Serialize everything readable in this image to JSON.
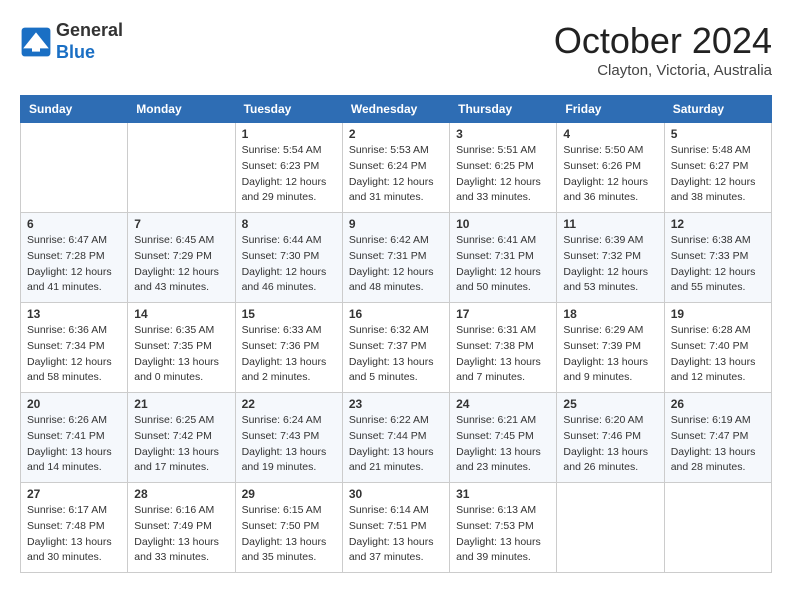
{
  "header": {
    "logo_line1": "General",
    "logo_line2": "Blue",
    "month": "October 2024",
    "location": "Clayton, Victoria, Australia"
  },
  "days_of_week": [
    "Sunday",
    "Monday",
    "Tuesday",
    "Wednesday",
    "Thursday",
    "Friday",
    "Saturday"
  ],
  "weeks": [
    [
      {
        "day": null
      },
      {
        "day": null
      },
      {
        "day": "1",
        "sunrise": "5:54 AM",
        "sunset": "6:23 PM",
        "daylight": "12 hours and 29 minutes."
      },
      {
        "day": "2",
        "sunrise": "5:53 AM",
        "sunset": "6:24 PM",
        "daylight": "12 hours and 31 minutes."
      },
      {
        "day": "3",
        "sunrise": "5:51 AM",
        "sunset": "6:25 PM",
        "daylight": "12 hours and 33 minutes."
      },
      {
        "day": "4",
        "sunrise": "5:50 AM",
        "sunset": "6:26 PM",
        "daylight": "12 hours and 36 minutes."
      },
      {
        "day": "5",
        "sunrise": "5:48 AM",
        "sunset": "6:27 PM",
        "daylight": "12 hours and 38 minutes."
      }
    ],
    [
      {
        "day": "6",
        "sunrise": "6:47 AM",
        "sunset": "7:28 PM",
        "daylight": "12 hours and 41 minutes."
      },
      {
        "day": "7",
        "sunrise": "6:45 AM",
        "sunset": "7:29 PM",
        "daylight": "12 hours and 43 minutes."
      },
      {
        "day": "8",
        "sunrise": "6:44 AM",
        "sunset": "7:30 PM",
        "daylight": "12 hours and 46 minutes."
      },
      {
        "day": "9",
        "sunrise": "6:42 AM",
        "sunset": "7:31 PM",
        "daylight": "12 hours and 48 minutes."
      },
      {
        "day": "10",
        "sunrise": "6:41 AM",
        "sunset": "7:31 PM",
        "daylight": "12 hours and 50 minutes."
      },
      {
        "day": "11",
        "sunrise": "6:39 AM",
        "sunset": "7:32 PM",
        "daylight": "12 hours and 53 minutes."
      },
      {
        "day": "12",
        "sunrise": "6:38 AM",
        "sunset": "7:33 PM",
        "daylight": "12 hours and 55 minutes."
      }
    ],
    [
      {
        "day": "13",
        "sunrise": "6:36 AM",
        "sunset": "7:34 PM",
        "daylight": "12 hours and 58 minutes."
      },
      {
        "day": "14",
        "sunrise": "6:35 AM",
        "sunset": "7:35 PM",
        "daylight": "13 hours and 0 minutes."
      },
      {
        "day": "15",
        "sunrise": "6:33 AM",
        "sunset": "7:36 PM",
        "daylight": "13 hours and 2 minutes."
      },
      {
        "day": "16",
        "sunrise": "6:32 AM",
        "sunset": "7:37 PM",
        "daylight": "13 hours and 5 minutes."
      },
      {
        "day": "17",
        "sunrise": "6:31 AM",
        "sunset": "7:38 PM",
        "daylight": "13 hours and 7 minutes."
      },
      {
        "day": "18",
        "sunrise": "6:29 AM",
        "sunset": "7:39 PM",
        "daylight": "13 hours and 9 minutes."
      },
      {
        "day": "19",
        "sunrise": "6:28 AM",
        "sunset": "7:40 PM",
        "daylight": "13 hours and 12 minutes."
      }
    ],
    [
      {
        "day": "20",
        "sunrise": "6:26 AM",
        "sunset": "7:41 PM",
        "daylight": "13 hours and 14 minutes."
      },
      {
        "day": "21",
        "sunrise": "6:25 AM",
        "sunset": "7:42 PM",
        "daylight": "13 hours and 17 minutes."
      },
      {
        "day": "22",
        "sunrise": "6:24 AM",
        "sunset": "7:43 PM",
        "daylight": "13 hours and 19 minutes."
      },
      {
        "day": "23",
        "sunrise": "6:22 AM",
        "sunset": "7:44 PM",
        "daylight": "13 hours and 21 minutes."
      },
      {
        "day": "24",
        "sunrise": "6:21 AM",
        "sunset": "7:45 PM",
        "daylight": "13 hours and 23 minutes."
      },
      {
        "day": "25",
        "sunrise": "6:20 AM",
        "sunset": "7:46 PM",
        "daylight": "13 hours and 26 minutes."
      },
      {
        "day": "26",
        "sunrise": "6:19 AM",
        "sunset": "7:47 PM",
        "daylight": "13 hours and 28 minutes."
      }
    ],
    [
      {
        "day": "27",
        "sunrise": "6:17 AM",
        "sunset": "7:48 PM",
        "daylight": "13 hours and 30 minutes."
      },
      {
        "day": "28",
        "sunrise": "6:16 AM",
        "sunset": "7:49 PM",
        "daylight": "13 hours and 33 minutes."
      },
      {
        "day": "29",
        "sunrise": "6:15 AM",
        "sunset": "7:50 PM",
        "daylight": "13 hours and 35 minutes."
      },
      {
        "day": "30",
        "sunrise": "6:14 AM",
        "sunset": "7:51 PM",
        "daylight": "13 hours and 37 minutes."
      },
      {
        "day": "31",
        "sunrise": "6:13 AM",
        "sunset": "7:53 PM",
        "daylight": "13 hours and 39 minutes."
      },
      {
        "day": null
      },
      {
        "day": null
      }
    ]
  ]
}
